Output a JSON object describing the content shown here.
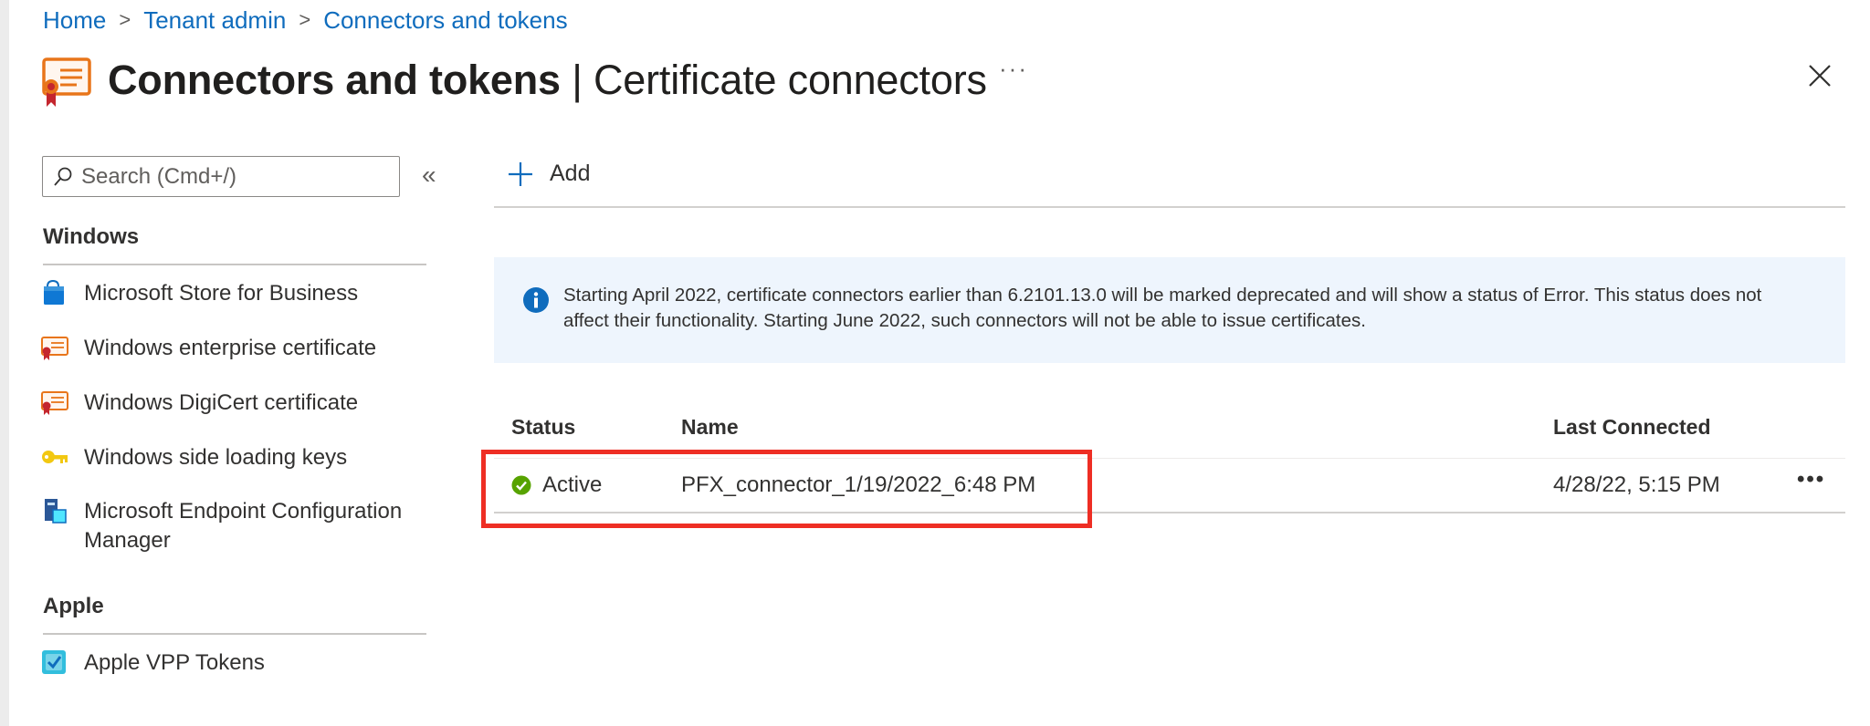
{
  "breadcrumb": {
    "items": [
      "Home",
      "Tenant admin",
      "Connectors and tokens"
    ]
  },
  "header": {
    "title_bold": "Connectors and tokens",
    "title_rest": " | Certificate connectors",
    "more_label": "···",
    "close_icon": "close-icon"
  },
  "sidebar": {
    "search_placeholder": "Search (Cmd+/)",
    "collapse_label": "«",
    "groups": [
      {
        "title": "Windows",
        "items": [
          {
            "label": "Microsoft Store for Business",
            "icon": "store-bag-icon"
          },
          {
            "label": "Windows enterprise certificate",
            "icon": "certificate-icon"
          },
          {
            "label": "Windows DigiCert certificate",
            "icon": "certificate-icon"
          },
          {
            "label": "Windows side loading keys",
            "icon": "key-icon"
          },
          {
            "label": "Microsoft Endpoint Configuration Manager",
            "icon": "configuration-manager-icon"
          }
        ]
      },
      {
        "title": "Apple",
        "items": [
          {
            "label": "Apple VPP Tokens",
            "icon": "vpp-token-icon"
          }
        ]
      }
    ]
  },
  "toolbar": {
    "add_label": "Add"
  },
  "info_banner": {
    "text": "Starting April 2022, certificate connectors earlier than 6.2101.13.0 will be marked deprecated and will show a status of Error. This status does not affect their functionality. Starting June 2022, such connectors will not be able to issue certificates."
  },
  "table": {
    "columns": [
      "Status",
      "Name",
      "Last Connected"
    ],
    "rows": [
      {
        "status": "Active",
        "name": "PFX_connector_1/19/2022_6:48 PM",
        "last_connected": "4/28/22, 5:15 PM",
        "more_label": "•••"
      }
    ]
  },
  "colors": {
    "link": "#0f6cbd",
    "banner_bg": "#eef5fd",
    "info_blue": "#0f6cbd",
    "success_green": "#57a300",
    "highlight_red": "#ee2e24"
  }
}
